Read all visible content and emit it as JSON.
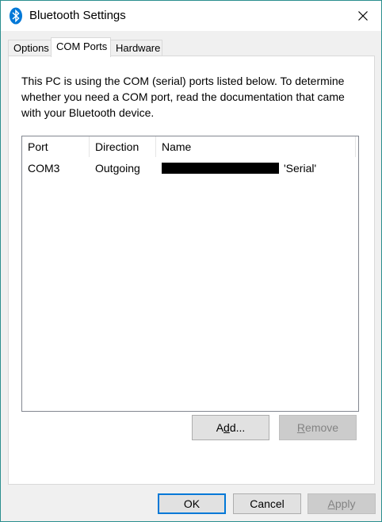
{
  "window": {
    "title": "Bluetooth Settings",
    "icon": "bluetooth-icon",
    "accent_color": "#0078d7"
  },
  "tabs": [
    {
      "label": "Options",
      "active": false
    },
    {
      "label": "COM Ports",
      "active": true
    },
    {
      "label": "Hardware",
      "active": false
    }
  ],
  "com_ports": {
    "description": "This PC is using the COM (serial) ports listed below. To determine whether you need a COM port, read the documentation that came with your Bluetooth device.",
    "columns": [
      "Port",
      "Direction",
      "Name"
    ],
    "rows": [
      {
        "port": "COM3",
        "direction": "Outgoing",
        "name_suffix": "'Serial'"
      }
    ],
    "add_button": {
      "pre": "A",
      "underlined": "d",
      "post": "d..."
    },
    "remove_button": {
      "underlined": "R",
      "post": "emove"
    }
  },
  "footer": {
    "ok_label": "OK",
    "cancel_label": "Cancel",
    "apply_pre": "",
    "apply_underlined": "A",
    "apply_post": "pply"
  }
}
